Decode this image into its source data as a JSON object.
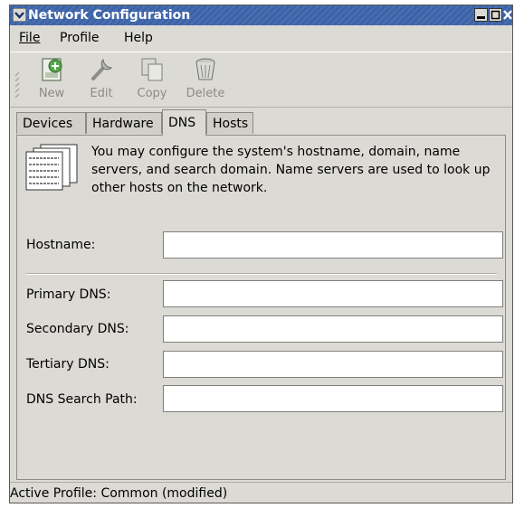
{
  "window": {
    "title": "Network Configuration",
    "accent_color": "#3c63a8"
  },
  "menubar": {
    "items": [
      {
        "label": "File"
      },
      {
        "label": "Profile"
      },
      {
        "label": "Help"
      }
    ]
  },
  "toolbar": {
    "buttons": [
      {
        "label": "New",
        "icon": "new-device-icon"
      },
      {
        "label": "Edit",
        "icon": "wrench-icon"
      },
      {
        "label": "Copy",
        "icon": "copy-icon"
      },
      {
        "label": "Delete",
        "icon": "trash-icon"
      }
    ]
  },
  "tabs": [
    {
      "label": "Devices"
    },
    {
      "label": "Hardware"
    },
    {
      "label": "DNS",
      "active": true
    },
    {
      "label": "Hosts"
    }
  ],
  "dns": {
    "description": "You may configure the system's hostname, domain, name servers, and search domain. Name servers are used to look up other hosts on the network.",
    "fields": {
      "hostname": {
        "label": "Hostname:",
        "value": ""
      },
      "primary_dns": {
        "label": "Primary DNS:",
        "value": ""
      },
      "secondary_dns": {
        "label": "Secondary DNS:",
        "value": ""
      },
      "tertiary_dns": {
        "label": "Tertiary DNS:",
        "value": ""
      },
      "search_path": {
        "label": "DNS Search Path:",
        "value": ""
      }
    }
  },
  "status": {
    "text": "Active Profile: Common (modified)"
  }
}
